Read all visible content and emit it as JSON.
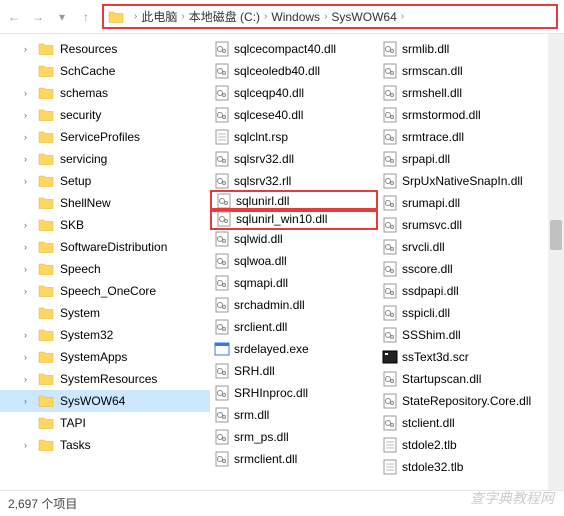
{
  "breadcrumb": {
    "items": [
      "此电脑",
      "本地磁盘 (C:)",
      "Windows",
      "SysWOW64"
    ]
  },
  "tree": [
    {
      "label": "Resources",
      "exp": "›"
    },
    {
      "label": "SchCache",
      "exp": ""
    },
    {
      "label": "schemas",
      "exp": "›"
    },
    {
      "label": "security",
      "exp": "›"
    },
    {
      "label": "ServiceProfiles",
      "exp": "›"
    },
    {
      "label": "servicing",
      "exp": "›"
    },
    {
      "label": "Setup",
      "exp": "›"
    },
    {
      "label": "ShellNew",
      "exp": ""
    },
    {
      "label": "SKB",
      "exp": "›"
    },
    {
      "label": "SoftwareDistribution",
      "exp": "›"
    },
    {
      "label": "Speech",
      "exp": "›"
    },
    {
      "label": "Speech_OneCore",
      "exp": "›"
    },
    {
      "label": "System",
      "exp": ""
    },
    {
      "label": "System32",
      "exp": "›"
    },
    {
      "label": "SystemApps",
      "exp": "›"
    },
    {
      "label": "SystemResources",
      "exp": "›"
    },
    {
      "label": "SysWOW64",
      "exp": "›",
      "selected": true
    },
    {
      "label": "TAPI",
      "exp": ""
    },
    {
      "label": "Tasks",
      "exp": "›"
    }
  ],
  "files_col1": [
    {
      "name": "sqlcecompact40.dll",
      "type": "dll"
    },
    {
      "name": "sqlceoledb40.dll",
      "type": "dll"
    },
    {
      "name": "sqlceqp40.dll",
      "type": "dll"
    },
    {
      "name": "sqlcese40.dll",
      "type": "dll"
    },
    {
      "name": "sqlclnt.rsp",
      "type": "file"
    },
    {
      "name": "sqlsrv32.dll",
      "type": "dll"
    },
    {
      "name": "sqlsrv32.rll",
      "type": "dll"
    },
    {
      "name": "sqlunirl.dll",
      "type": "dll",
      "boxed": true
    },
    {
      "name": "sqlunirl_win10.dll",
      "type": "dll",
      "boxed": true
    },
    {
      "name": "sqlwid.dll",
      "type": "dll"
    },
    {
      "name": "sqlwoa.dll",
      "type": "dll"
    },
    {
      "name": "sqmapi.dll",
      "type": "dll"
    },
    {
      "name": "srchadmin.dll",
      "type": "dll"
    },
    {
      "name": "srclient.dll",
      "type": "dll"
    },
    {
      "name": "srdelayed.exe",
      "type": "exe"
    },
    {
      "name": "SRH.dll",
      "type": "dll"
    },
    {
      "name": "SRHInproc.dll",
      "type": "dll"
    },
    {
      "name": "srm.dll",
      "type": "dll"
    },
    {
      "name": "srm_ps.dll",
      "type": "dll"
    },
    {
      "name": "srmclient.dll",
      "type": "dll"
    }
  ],
  "files_col2": [
    {
      "name": "srmlib.dll",
      "type": "dll"
    },
    {
      "name": "srmscan.dll",
      "type": "dll"
    },
    {
      "name": "srmshell.dll",
      "type": "dll"
    },
    {
      "name": "srmstormod.dll",
      "type": "dll"
    },
    {
      "name": "srmtrace.dll",
      "type": "dll"
    },
    {
      "name": "srpapi.dll",
      "type": "dll"
    },
    {
      "name": "SrpUxNativeSnapIn.dll",
      "type": "dll"
    },
    {
      "name": "srumapi.dll",
      "type": "dll"
    },
    {
      "name": "srumsvc.dll",
      "type": "dll"
    },
    {
      "name": "srvcli.dll",
      "type": "dll"
    },
    {
      "name": "sscore.dll",
      "type": "dll"
    },
    {
      "name": "ssdpapi.dll",
      "type": "dll"
    },
    {
      "name": "sspicli.dll",
      "type": "dll"
    },
    {
      "name": "SSShim.dll",
      "type": "dll"
    },
    {
      "name": "ssText3d.scr",
      "type": "scr"
    },
    {
      "name": "Startupscan.dll",
      "type": "dll"
    },
    {
      "name": "StateRepository.Core.dll",
      "type": "dll"
    },
    {
      "name": "stclient.dll",
      "type": "dll"
    },
    {
      "name": "stdole2.tlb",
      "type": "file"
    },
    {
      "name": "stdole32.tlb",
      "type": "file"
    }
  ],
  "status": {
    "text": "2,697 个项目"
  },
  "watermark": "查字典教程网"
}
